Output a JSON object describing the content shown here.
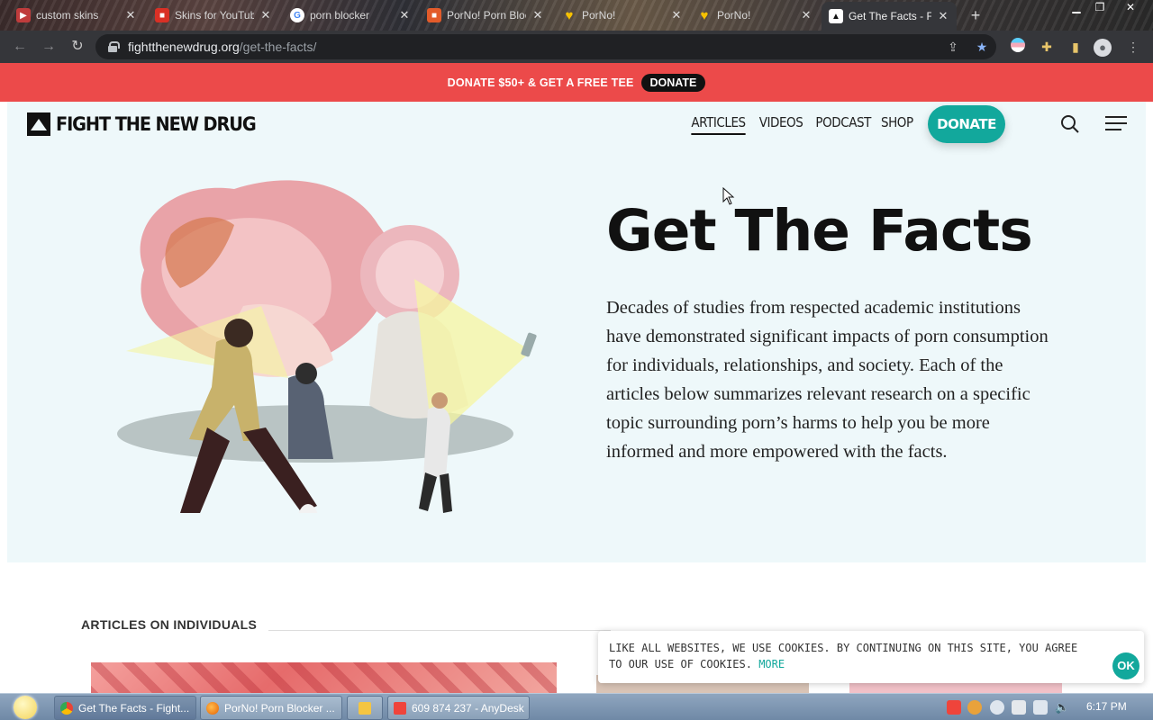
{
  "browser": {
    "tabs": [
      {
        "title": "custom skins",
        "favicon_color": "#e04b4b"
      },
      {
        "title": "Skins for YouTube",
        "favicon_color": "#d93025"
      },
      {
        "title": "porn blocker",
        "favicon_color": "#4285f4"
      },
      {
        "title": "PorNo! Porn Blocker",
        "favicon_color": "#e35b2a"
      },
      {
        "title": "PorNo!",
        "favicon_color": "#f6c100"
      },
      {
        "title": "PorNo!",
        "favicon_color": "#f6c100"
      },
      {
        "title": "Get The Facts - Fight the New Drug",
        "favicon_color": "#ffffff",
        "active": true
      }
    ],
    "url_host": "fightthenewdrug.org",
    "url_path": "/get-the-facts/"
  },
  "site": {
    "promo_text": "DONATE $50+ & GET A FREE TEE",
    "promo_button": "DONATE",
    "logo_text": "FIGHT THE NEW DRUG",
    "nav": [
      "ARTICLES",
      "VIDEOS",
      "PODCAST",
      "SHOP"
    ],
    "donate_button": "DONATE",
    "accent_color": "#12a89c",
    "promo_color": "#ec4a4a"
  },
  "hero": {
    "title": "Get The Facts",
    "body": "Decades of studies from respected academic institutions have demonstrated significant impacts of porn consumption for individuals, relationships, and society. Each of the articles below summarizes relevant research on a specific topic surrounding porn’s harms to help you be more informed and more empowered with the facts."
  },
  "section": {
    "label": "ARTICLES ON INDIVIDUALS"
  },
  "cookie": {
    "text": "LIKE ALL WEBSITES, WE USE COOKIES. BY CONTINUING ON THIS SITE, YOU AGREE TO OUR USE OF COOKIES.",
    "more": "MORE",
    "ok": "OK"
  },
  "taskbar": {
    "items": [
      {
        "label": "Get The Facts - Fight...",
        "icon_color": "#4285f4"
      },
      {
        "label": "PorNo! Porn Blocker ...",
        "icon_color": "#e66000"
      },
      {
        "label": "",
        "icon_color": "#f4c542"
      },
      {
        "label": "609 874 237 - AnyDesk",
        "icon_color": "#ef443b"
      }
    ],
    "clock": "6:17 PM"
  }
}
